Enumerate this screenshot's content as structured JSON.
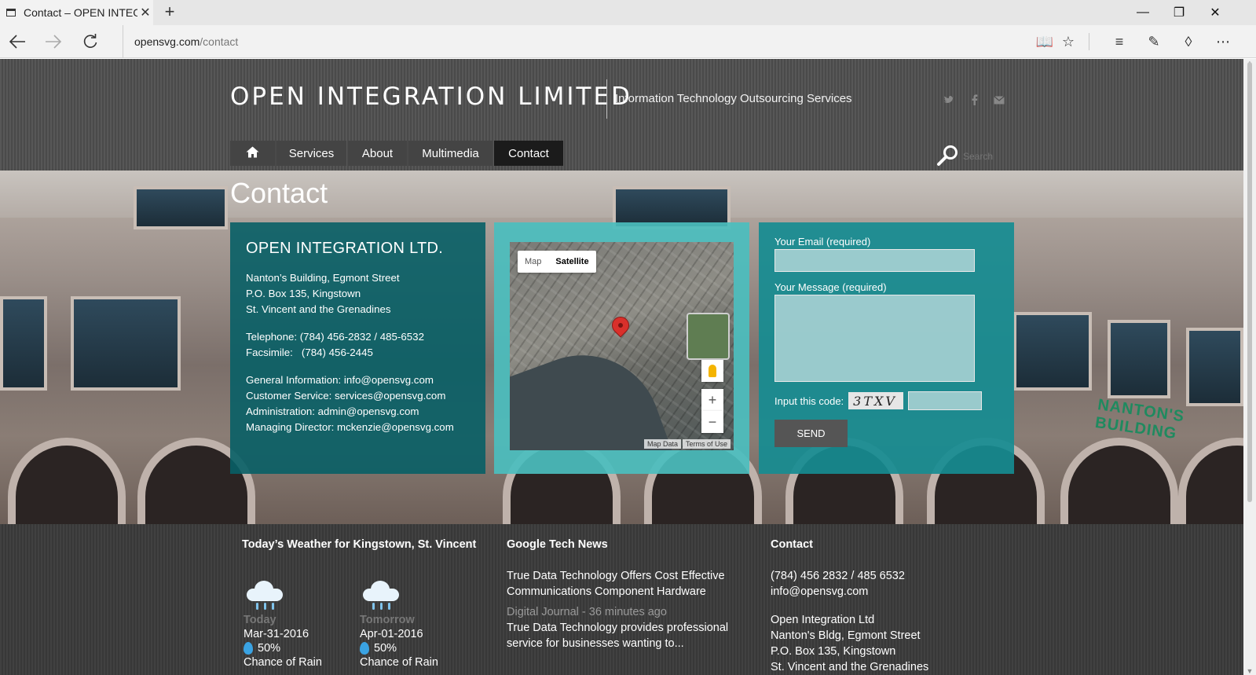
{
  "browser": {
    "tab_title": "Contact – OPEN INTEGR",
    "url_domain": "opensvg.com",
    "url_path": "/contact"
  },
  "site": {
    "title": "OPEN INTEGRATION LIMITED",
    "tagline": "Information Technology Outsourcing Services",
    "nav": [
      "Services",
      "About",
      "Multimedia",
      "Contact"
    ],
    "active_nav": "Contact",
    "search_placeholder": "Search"
  },
  "page": {
    "heading": "Contact"
  },
  "info": {
    "company": "OPEN INTEGRATION LTD.",
    "address": [
      "Nanton’s Building, Egmont Street",
      "P.O. Box 135, Kingstown",
      "St. Vincent and the Grenadines"
    ],
    "phones": [
      "Telephone: (784) 456-2832 / 485-6532",
      "Facsimile:   (784) 456-2445"
    ],
    "emails": [
      "General Information: info@opensvg.com",
      "Customer Service: services@opensvg.com",
      "Administration: admin@opensvg.com",
      "Managing Director: mckenzie@opensvg.com"
    ]
  },
  "map": {
    "toggle_map": "Map",
    "toggle_satellite": "Satellite",
    "zoom_in": "+",
    "zoom_out": "−",
    "footer_data": "Map Data",
    "footer_terms": "Terms of Use"
  },
  "form": {
    "email_label": "Your Email (required)",
    "message_label": "Your Message (required)",
    "code_label": "Input this code:",
    "captcha_code": "3TXV",
    "send_label": "SEND"
  },
  "hero": {
    "sign_text": "NANTON'S BUILDING"
  },
  "footer": {
    "weather": {
      "title": "Today’s Weather for Kingstown, St. Vincent",
      "days": [
        {
          "label": "Today",
          "date": "Mar-31-2016",
          "chance": "50%",
          "desc": "Chance of Rain"
        },
        {
          "label": "Tomorrow",
          "date": "Apr-01-2016",
          "chance": "50%",
          "desc": "Chance of Rain"
        }
      ]
    },
    "news": {
      "title": "Google Tech News",
      "headline": "True Data Technology Offers Cost Effective Communications Component Hardware",
      "meta": "Digital Journal - 36 minutes ago",
      "snippet": "True Data Technology provides professional service for businesses wanting to..."
    },
    "contact": {
      "title": "Contact",
      "phone": "(784) 456 2832 / 485 6532",
      "email": "info@opensvg.com",
      "address": [
        "Open Integration Ltd",
        "Nanton's Bldg, Egmont Street",
        "P.O. Box 135, Kingstown",
        "St. Vincent and the Grenadines"
      ]
    }
  },
  "colors": {
    "info_panel": "#085f66",
    "map_panel": "#4bbebe",
    "form_panel": "#168c91",
    "header_bg": "#505050",
    "footer_bg": "#3d3d3d"
  }
}
